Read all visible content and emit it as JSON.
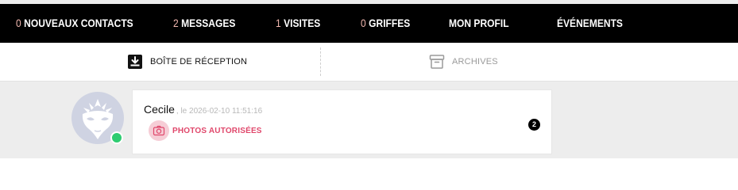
{
  "nav": {
    "items": [
      {
        "count": "0",
        "label": "NOUVEAUX CONTACTS"
      },
      {
        "count": "2",
        "label": "MESSAGES"
      },
      {
        "count": "1",
        "label": "VISITES"
      },
      {
        "count": "0",
        "label": "GRIFFES"
      },
      {
        "count": "",
        "label": "MON PROFIL"
      },
      {
        "count": "",
        "label": "ÉVÉNEMENTS"
      }
    ]
  },
  "tabs": {
    "inbox": {
      "label": "BOÎTE DE RÉCEPTION",
      "icon": "inbox-download-icon"
    },
    "archives": {
      "label": "ARCHIVES",
      "icon": "archive-box-icon"
    }
  },
  "messages": [
    {
      "sender": "Cecile",
      "meta": ", le 2026-02-10 11:51:16",
      "photo_label": "PHOTOS AUTORISÉES",
      "photo_icon": "camera-icon",
      "unread_count": "2",
      "avatar_icon": "venetian-mask-icon",
      "online": true
    }
  ],
  "colors": {
    "nav_bg": "#000000",
    "nav_count": "#f2b8b0",
    "accent_pink": "#e0476b",
    "online_green": "#2ecc71",
    "page_bg": "#ededed"
  }
}
